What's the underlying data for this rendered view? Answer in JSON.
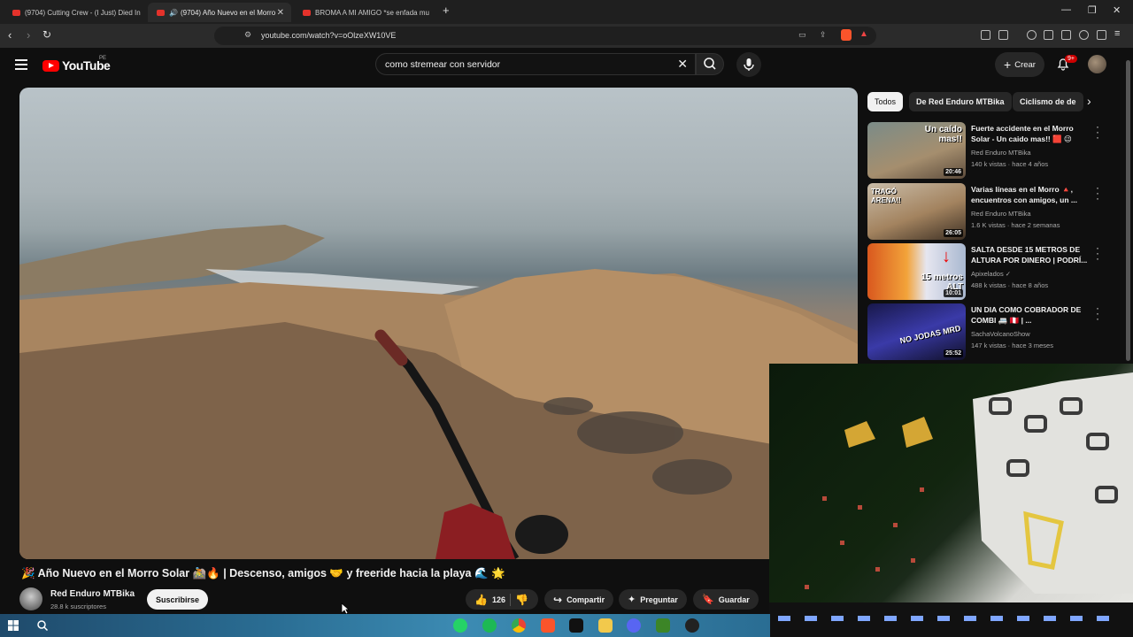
{
  "tabs": [
    {
      "label": "(9704) Cutting Crew - (I Just) Died In"
    },
    {
      "label": "(9704) Año Nuevo en el Morro"
    },
    {
      "label": "BROMA A MI AMIGO *se enfada mu"
    }
  ],
  "address_bar": {
    "url": "youtube.com/watch?v=oOlzeXW10VE"
  },
  "youtube": {
    "logo_text": "YouTube",
    "country_code": "PE",
    "search_query": "como stremear con servidor",
    "create_label": "Crear",
    "notifications_badge": "9+"
  },
  "chips": [
    "Todos",
    "De Red Enduro MTBika",
    "Ciclismo de de"
  ],
  "recommendations": [
    {
      "title": "Fuerte accidente en el Morro Solar - Un caido mas!! 🟥 😉",
      "channel": "Red Enduro MTBika",
      "meta": "140 k vistas · hace 4 años",
      "duration": "20:46",
      "thumb_text": "Un caído mas!!"
    },
    {
      "title": "Varias líneas en el Morro 🔺, encuentros con amigos, un ...",
      "channel": "Red Enduro MTBika",
      "meta": "1.6 K vistas · hace 2 semanas",
      "duration": "26:05",
      "thumb_text": "TRAGÓ ARENA!!"
    },
    {
      "title": "SALTA DESDE 15 METROS DE ALTURA POR DINERO | PODRÍ...",
      "channel": "Apixelados",
      "meta": "488 k vistas · hace 8 años",
      "duration": "10:01",
      "thumb_text": "15 metros ALT"
    },
    {
      "title": "UN DIA COMO COBRADOR DE COMBI 🚐 🇵🇪 | ...",
      "channel": "SachaVolcanoShow",
      "meta": "147 k vistas · hace 3 meses",
      "duration": "25:52",
      "thumb_text": "NO JODAS MRD"
    }
  ],
  "video": {
    "title": "🎉 Año Nuevo en el Morro Solar 🚵🔥 | Descenso, amigos 🤝 y freeride hacia la playa 🌊 🌟",
    "channel": "Red Enduro MTBika",
    "subscribers": "28.8 k suscriptores",
    "subscribe_label": "Suscribirse",
    "likes": "126",
    "share_label": "Compartir",
    "ask_label": "Preguntar",
    "save_label": "Guardar"
  },
  "colors": {
    "bg": "#0f0f0f",
    "accent_red": "#ff0000",
    "chip_bg": "#272727"
  }
}
